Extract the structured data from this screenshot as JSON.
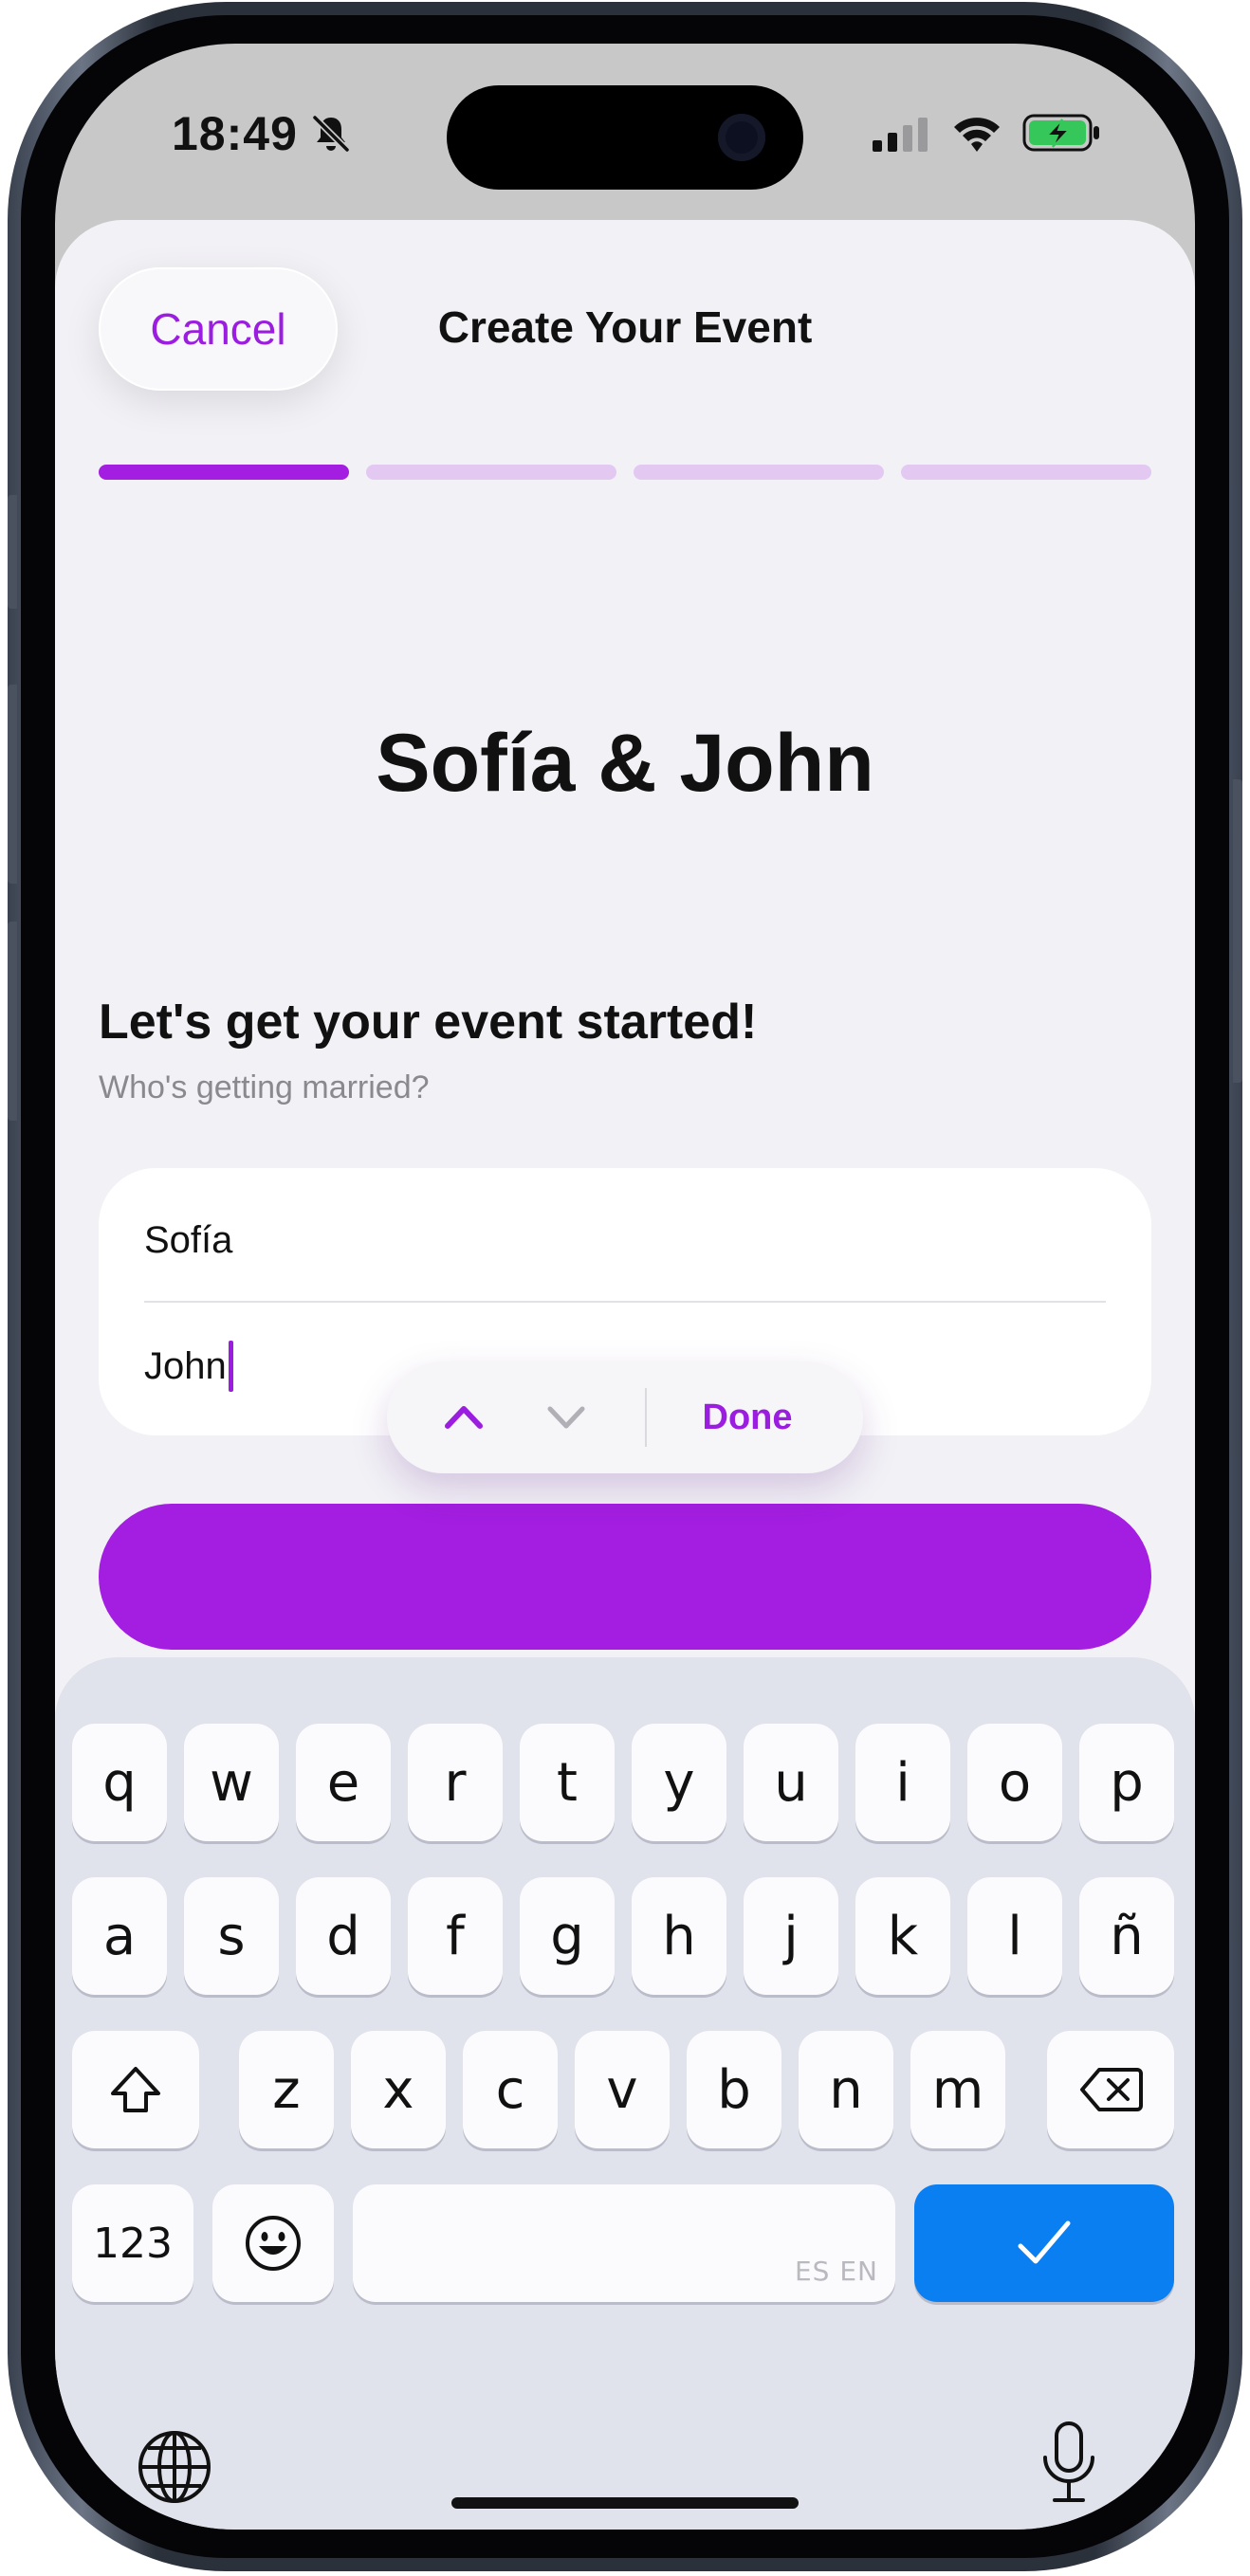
{
  "status_bar": {
    "time": "18:49",
    "icons": [
      "bell-slash-icon",
      "cellular-signal-icon",
      "wifi-icon",
      "battery-charging-icon"
    ]
  },
  "header": {
    "cancel_label": "Cancel",
    "title": "Create Your Event"
  },
  "progress": {
    "total_steps": 4,
    "current_step": 1,
    "active_color": "#a31ee0",
    "inactive_color": "#e3c9f2"
  },
  "main": {
    "names_heading": "Sofía & John",
    "intro_title": "Let's get your event started!",
    "intro_subtitle": "Who's getting married?",
    "partner1_value": "Sofía",
    "partner2_value": "John"
  },
  "input_accessory": {
    "up_icon": "chevron-up-icon",
    "down_icon": "chevron-down-icon",
    "done_label": "Done"
  },
  "keyboard": {
    "row1": [
      "q",
      "w",
      "e",
      "r",
      "t",
      "y",
      "u",
      "i",
      "o",
      "p"
    ],
    "row2": [
      "a",
      "s",
      "d",
      "f",
      "g",
      "h",
      "j",
      "k",
      "l",
      "ñ"
    ],
    "row3": [
      "z",
      "x",
      "c",
      "v",
      "b",
      "n",
      "m"
    ],
    "numbers_label": "123",
    "space_lang_label": "ES EN",
    "accent_color": "#0a7ff2",
    "icons": [
      "shift-icon",
      "backspace-icon",
      "emoji-icon",
      "checkmark-icon",
      "globe-icon",
      "microphone-icon"
    ]
  },
  "colors": {
    "brand_purple": "#a31ee0",
    "sheet_background": "#f2f1f6",
    "keyboard_background": "#e0e2ec"
  }
}
